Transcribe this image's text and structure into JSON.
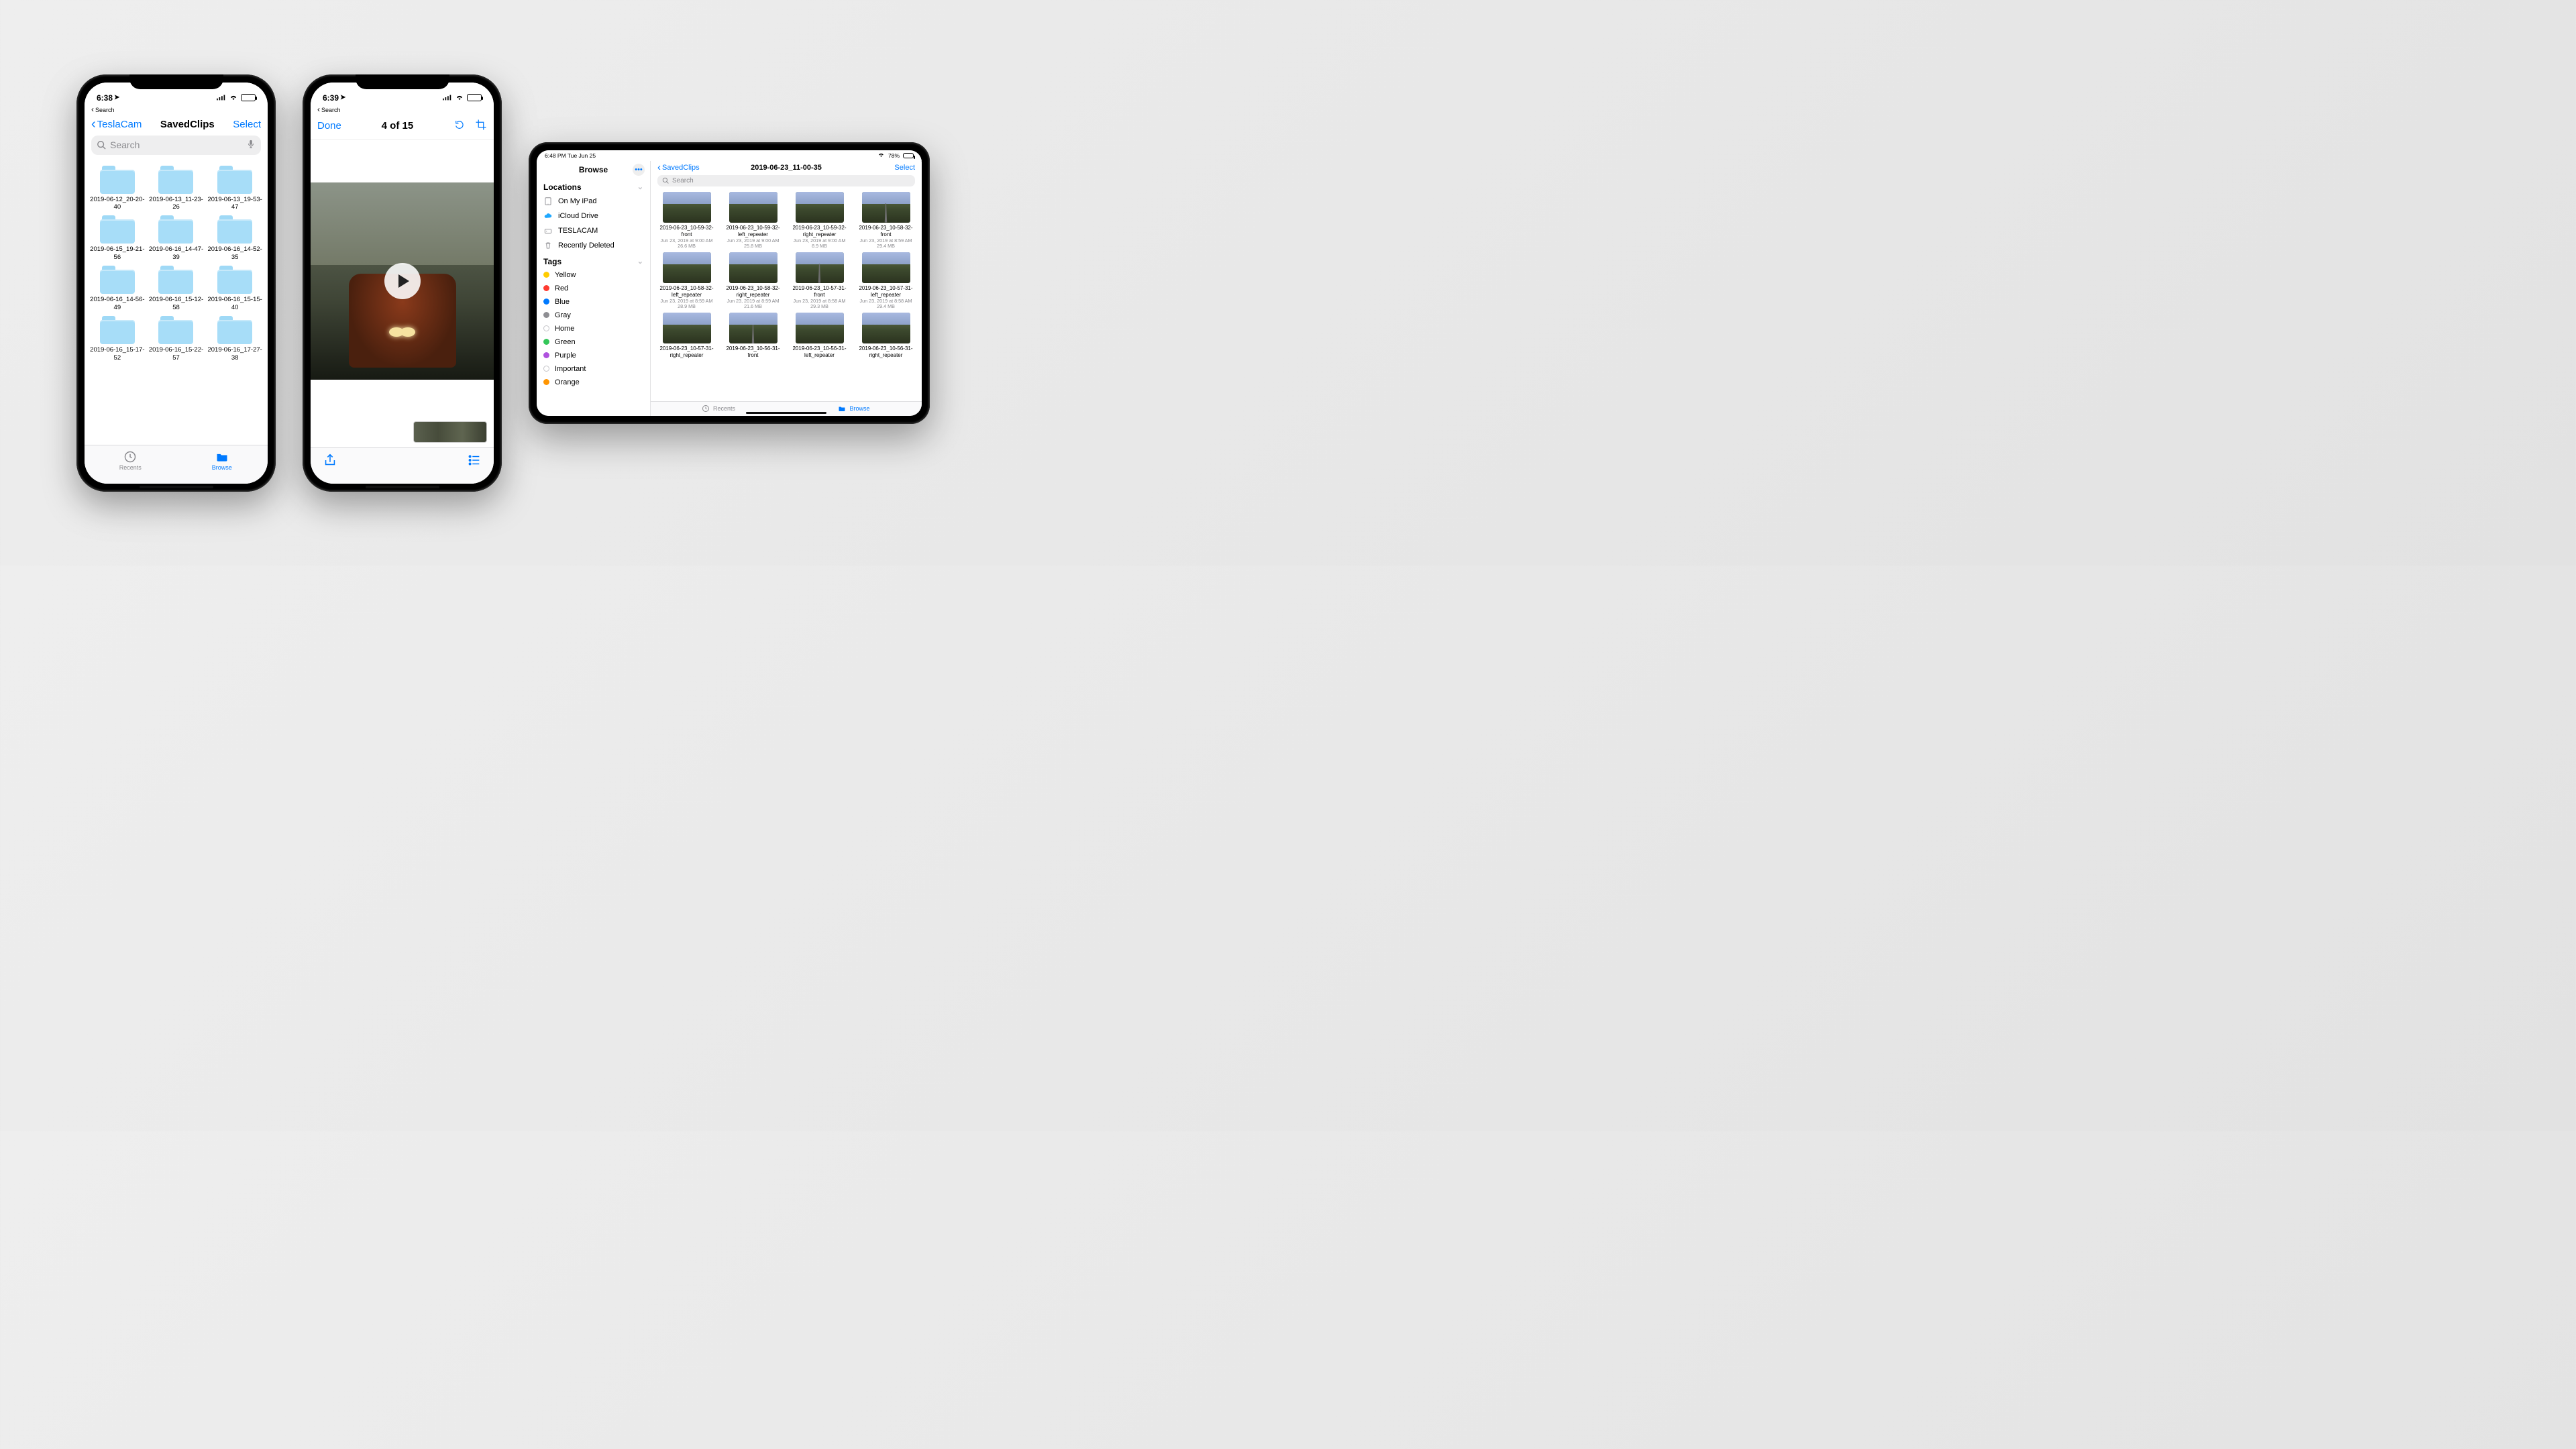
{
  "colors": {
    "ios_blue": "#007aff",
    "battery_green": "#34c759"
  },
  "phone1": {
    "status": {
      "time": "6:38",
      "back_to": "Search",
      "battery_pct": 80
    },
    "nav": {
      "back": "TeslaCam",
      "title": "SavedClips",
      "action": "Select"
    },
    "search": {
      "placeholder": "Search"
    },
    "folders": [
      "2019-06-12_20-20-40",
      "2019-06-13_11-23-26",
      "2019-06-13_19-53-47",
      "2019-06-15_19-21-56",
      "2019-06-16_14-47-39",
      "2019-06-16_14-52-35",
      "2019-06-16_14-56-49",
      "2019-06-16_15-12-58",
      "2019-06-16_15-15-40",
      "2019-06-16_15-17-52",
      "2019-06-16_15-22-57",
      "2019-06-16_17-27-38"
    ],
    "tabs": {
      "recents": "Recents",
      "browse": "Browse"
    }
  },
  "phone2": {
    "status": {
      "time": "6:39",
      "back_to": "Search",
      "battery_pct": 80
    },
    "nav": {
      "done": "Done",
      "counter": "4 of 15"
    }
  },
  "ipad": {
    "status": {
      "left": "6:48 PM   Tue Jun 25",
      "battery_text": "78%"
    },
    "sidebar": {
      "title": "Browse",
      "locations_header": "Locations",
      "locations": [
        {
          "label": "On My iPad",
          "icon": "ipad"
        },
        {
          "label": "iCloud Drive",
          "icon": "cloud"
        },
        {
          "label": "TESLACAM",
          "icon": "drive"
        },
        {
          "label": "Recently Deleted",
          "icon": "trash"
        }
      ],
      "tags_header": "Tags",
      "tags": [
        {
          "label": "Yellow",
          "color": "#ffcc00"
        },
        {
          "label": "Red",
          "color": "#ff3b30"
        },
        {
          "label": "Blue",
          "color": "#007aff"
        },
        {
          "label": "Gray",
          "color": "#8e8e93"
        },
        {
          "label": "Home",
          "color": "",
          "hollow": true
        },
        {
          "label": "Green",
          "color": "#34c759"
        },
        {
          "label": "Purple",
          "color": "#af52de"
        },
        {
          "label": "Important",
          "color": "",
          "hollow": true
        },
        {
          "label": "Orange",
          "color": "#ff9500"
        }
      ]
    },
    "main": {
      "back": "SavedClips",
      "title": "2019-06-23_11-00-35",
      "action": "Select",
      "search": {
        "placeholder": "Search"
      },
      "items": [
        {
          "name": "2019-06-23_10-59-32-front",
          "date": "Jun 23, 2019 at 9:00 AM",
          "size": "26.6 MB",
          "road": false
        },
        {
          "name": "2019-06-23_10-59-32-left_repeater",
          "date": "Jun 23, 2019 at 9:00 AM",
          "size": "25.8 MB",
          "road": false
        },
        {
          "name": "2019-06-23_10-59-32-right_repeater",
          "date": "Jun 23, 2019 at 9:00 AM",
          "size": "8.9 MB",
          "road": false
        },
        {
          "name": "2019-06-23_10-58-32-front",
          "date": "Jun 23, 2019 at 8:59 AM",
          "size": "29.4 MB",
          "road": true
        },
        {
          "name": "2019-06-23_10-58-32-left_repeater",
          "date": "Jun 23, 2019 at 8:59 AM",
          "size": "28.9 MB",
          "road": false
        },
        {
          "name": "2019-06-23_10-58-32-right_repeater",
          "date": "Jun 23, 2019 at 8:59 AM",
          "size": "21.6 MB",
          "road": false
        },
        {
          "name": "2019-06-23_10-57-31-front",
          "date": "Jun 23, 2019 at 8:58 AM",
          "size": "29.3 MB",
          "road": true
        },
        {
          "name": "2019-06-23_10-57-31-left_repeater",
          "date": "Jun 23, 2019 at 8:58 AM",
          "size": "29.4 MB",
          "road": false
        },
        {
          "name": "2019-06-23_10-57-31-right_repeater",
          "date": "",
          "size": "",
          "road": false
        },
        {
          "name": "2019-06-23_10-56-31-front",
          "date": "",
          "size": "",
          "road": true
        },
        {
          "name": "2019-06-23_10-56-31-left_repeater",
          "date": "",
          "size": "",
          "road": false
        },
        {
          "name": "2019-06-23_10-56-31-right_repeater",
          "date": "",
          "size": "",
          "road": false
        }
      ]
    },
    "tabs": {
      "recents": "Recents",
      "browse": "Browse"
    }
  }
}
